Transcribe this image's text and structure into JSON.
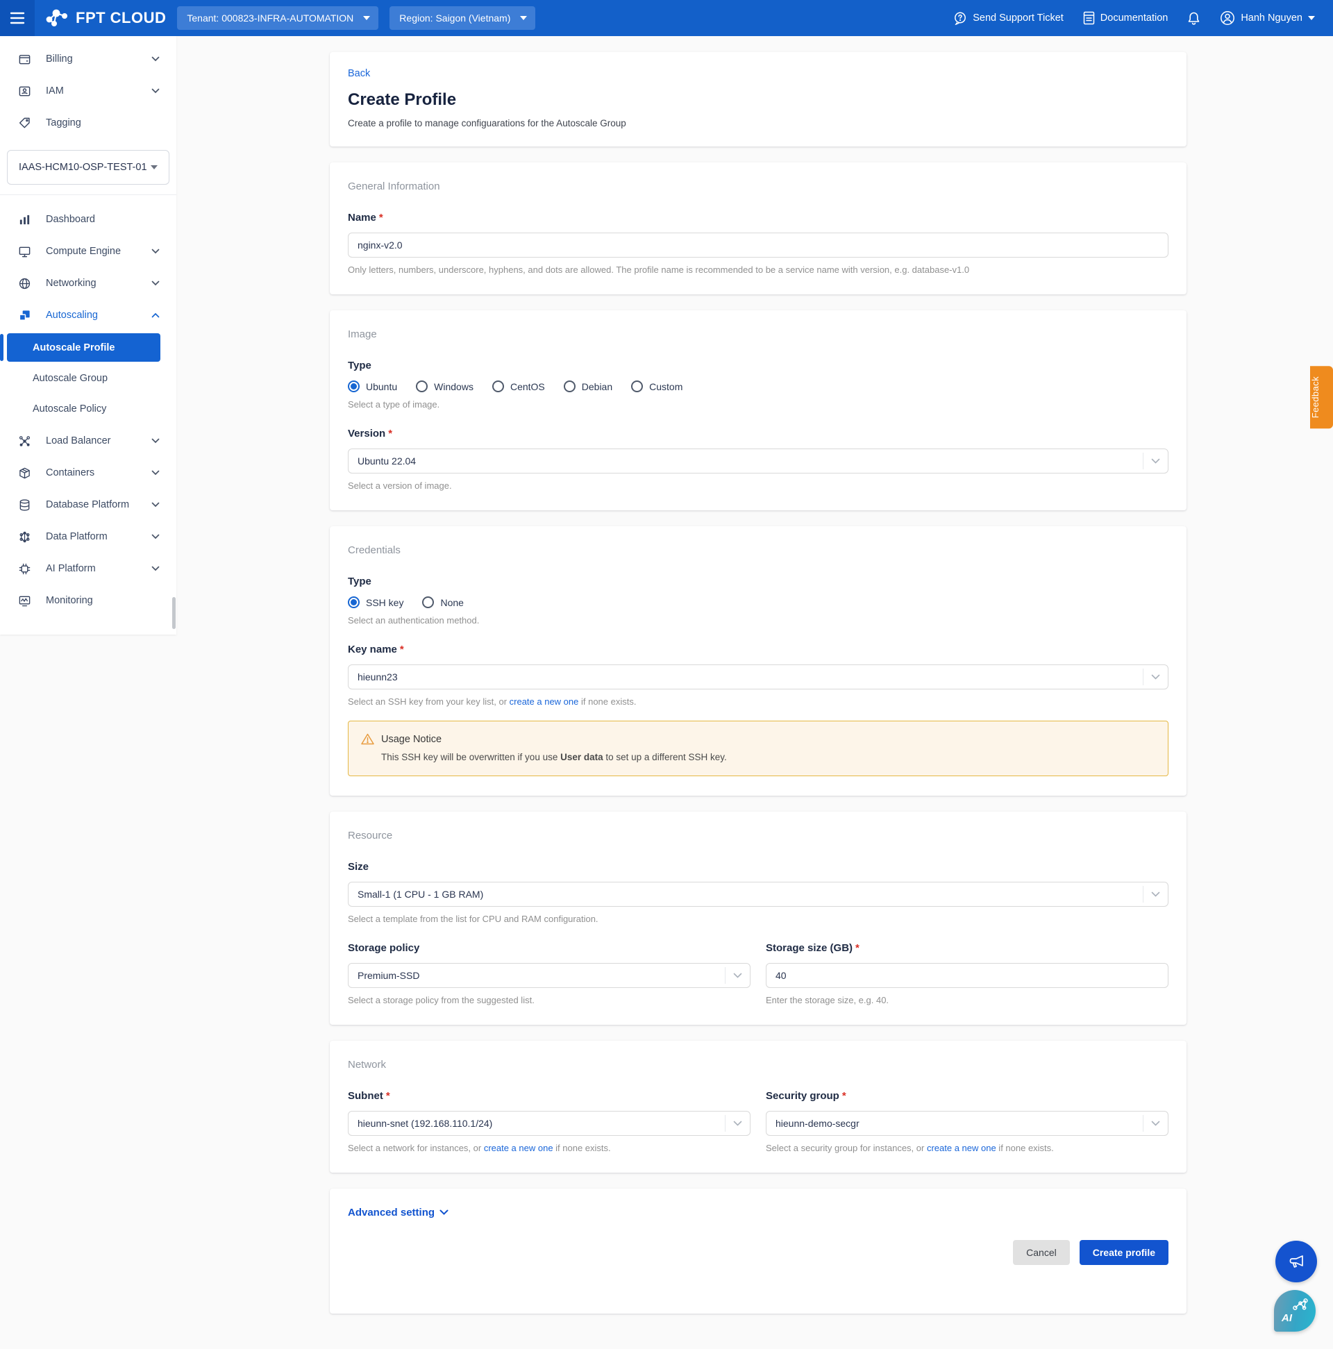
{
  "colors": {
    "navbar": "#1360c9",
    "accent": "#1463d2",
    "link": "#1a66d9",
    "warning_border": "#e5b844",
    "warning_bg": "#fdf5e9",
    "feedback_orange": "#ef8b1e"
  },
  "navbar": {
    "logo_text": "FPT CLOUD",
    "tenant": "Tenant: 000823-INFRA-AUTOMATION",
    "region": "Region: Saigon (Vietnam)",
    "support": "Send Support Ticket",
    "documentation": "Documentation",
    "user": "Hanh Nguyen"
  },
  "sidebar": {
    "top": [
      {
        "label": "Billing"
      },
      {
        "label": "IAM"
      },
      {
        "label": "Tagging"
      }
    ],
    "project": "IAAS-HCM10-OSP-TEST-01",
    "menu": [
      {
        "label": "Dashboard"
      },
      {
        "label": "Compute Engine"
      },
      {
        "label": "Networking"
      },
      {
        "label": "Autoscaling"
      },
      {
        "label": "Load Balancer"
      },
      {
        "label": "Containers"
      },
      {
        "label": "Database Platform"
      },
      {
        "label": "Data Platform"
      },
      {
        "label": "AI Platform"
      },
      {
        "label": "Monitoring"
      }
    ],
    "submenu": [
      {
        "label": "Autoscale Profile"
      },
      {
        "label": "Autoscale Group"
      },
      {
        "label": "Autoscale Policy"
      }
    ]
  },
  "page": {
    "back": "Back",
    "title": "Create Profile",
    "subtitle": "Create a profile to manage configuarations for the Autoscale Group"
  },
  "general": {
    "section_title": "General Information",
    "name_label": "Name",
    "name_value": "nginx-v2.0",
    "name_help": "Only letters, numbers, underscore, hyphens, and dots are allowed. The profile name is recommended to be a service name with version, e.g. database-v1.0"
  },
  "image": {
    "section_title": "Image",
    "type_label": "Type",
    "type_options": [
      "Ubuntu",
      "Windows",
      "CentOS",
      "Debian",
      "Custom"
    ],
    "type_selected": "Ubuntu",
    "type_help": "Select a type of image.",
    "version_label": "Version",
    "version_value": "Ubuntu 22.04",
    "version_help": "Select a version of image."
  },
  "credentials": {
    "section_title": "Credentials",
    "type_label": "Type",
    "type_options": [
      "SSH key",
      "None"
    ],
    "type_selected": "SSH key",
    "type_help": "Select an authentication method.",
    "key_label": "Key name",
    "key_value": "hieunn23",
    "key_help_prefix": "Select an SSH key from your key list, or ",
    "key_help_link": "create a new one",
    "key_help_suffix": " if none exists.",
    "notice_title": "Usage Notice",
    "notice_body_1": "This SSH key will be overwritten if you use ",
    "notice_body_bold": "User data",
    "notice_body_2": " to set up a different SSH key."
  },
  "resource": {
    "section_title": "Resource",
    "size_label": "Size",
    "size_value": "Small-1 (1 CPU - 1 GB RAM)",
    "size_help": "Select a template from the list for CPU and RAM configuration.",
    "storage_policy_label": "Storage policy",
    "storage_policy_value": "Premium-SSD",
    "storage_policy_help": "Select a storage policy from the suggested list.",
    "storage_size_label": "Storage size (GB)",
    "storage_size_value": "40",
    "storage_size_help": "Enter the storage size, e.g. 40."
  },
  "network": {
    "section_title": "Network",
    "subnet_label": "Subnet",
    "subnet_value": "hieunn-snet (192.168.110.1/24)",
    "subnet_help_prefix": "Select a network for instances, or ",
    "subnet_help_link": "create a new one",
    "subnet_help_suffix": " if none exists.",
    "secgroup_label": "Security group",
    "secgroup_value": "hieunn-demo-secgr",
    "secgroup_help_prefix": "Select a security group for instances, or ",
    "secgroup_help_link": "create a new one",
    "secgroup_help_suffix": " if none exists."
  },
  "footer": {
    "advanced": "Advanced setting",
    "cancel": "Cancel",
    "create": "Create profile"
  },
  "floating": {
    "feedback": "Feedback",
    "ai_label": "AI"
  }
}
